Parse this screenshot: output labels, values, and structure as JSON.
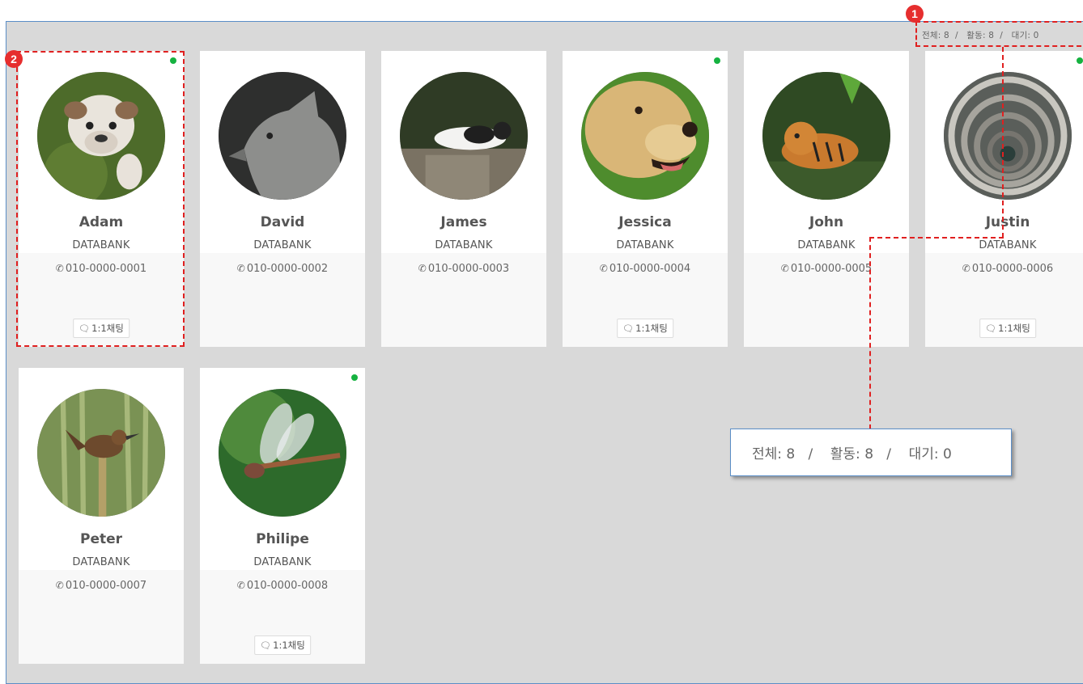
{
  "summary": {
    "text": "전체: 8  /   활동: 8  /   대기: 0"
  },
  "callout": {
    "text": "전체: 8   /    활동: 8   /    대기: 0"
  },
  "annotations": {
    "badge1": "1",
    "badge2": "2"
  },
  "colors": {
    "online_dot": "#15b240",
    "annotation_red": "#e02020",
    "frame_blue": "#5b8ec7"
  },
  "contacts": [
    {
      "name": "Adam",
      "org": "DATABANK",
      "phone": "010-0000-0001",
      "online": true,
      "chat_label": "1:1채팅",
      "photo": "bulldog-puppy"
    },
    {
      "name": "David",
      "org": "DATABANK",
      "phone": "010-0000-0002",
      "online": false,
      "chat_label": "",
      "photo": "grey-wolf"
    },
    {
      "name": "James",
      "org": "DATABANK",
      "phone": "010-0000-0003",
      "online": false,
      "chat_label": "",
      "photo": "cat-on-rock"
    },
    {
      "name": "Jessica",
      "org": "DATABANK",
      "phone": "010-0000-0004",
      "online": true,
      "chat_label": "1:1채팅",
      "photo": "golden-retriever"
    },
    {
      "name": "John",
      "org": "DATABANK",
      "phone": "010-0000-0005",
      "online": false,
      "chat_label": "",
      "photo": "tiger"
    },
    {
      "name": "Justin",
      "org": "DATABANK",
      "phone": "010-0000-0006",
      "online": true,
      "chat_label": "1:1채팅",
      "photo": "spiral-staircase"
    },
    {
      "name": "Peter",
      "org": "DATABANK",
      "phone": "010-0000-0007",
      "online": false,
      "chat_label": "",
      "photo": "wren-bird"
    },
    {
      "name": "Philipe",
      "org": "DATABANK",
      "phone": "010-0000-0008",
      "online": true,
      "chat_label": "1:1채팅",
      "photo": "dragonfly"
    }
  ]
}
